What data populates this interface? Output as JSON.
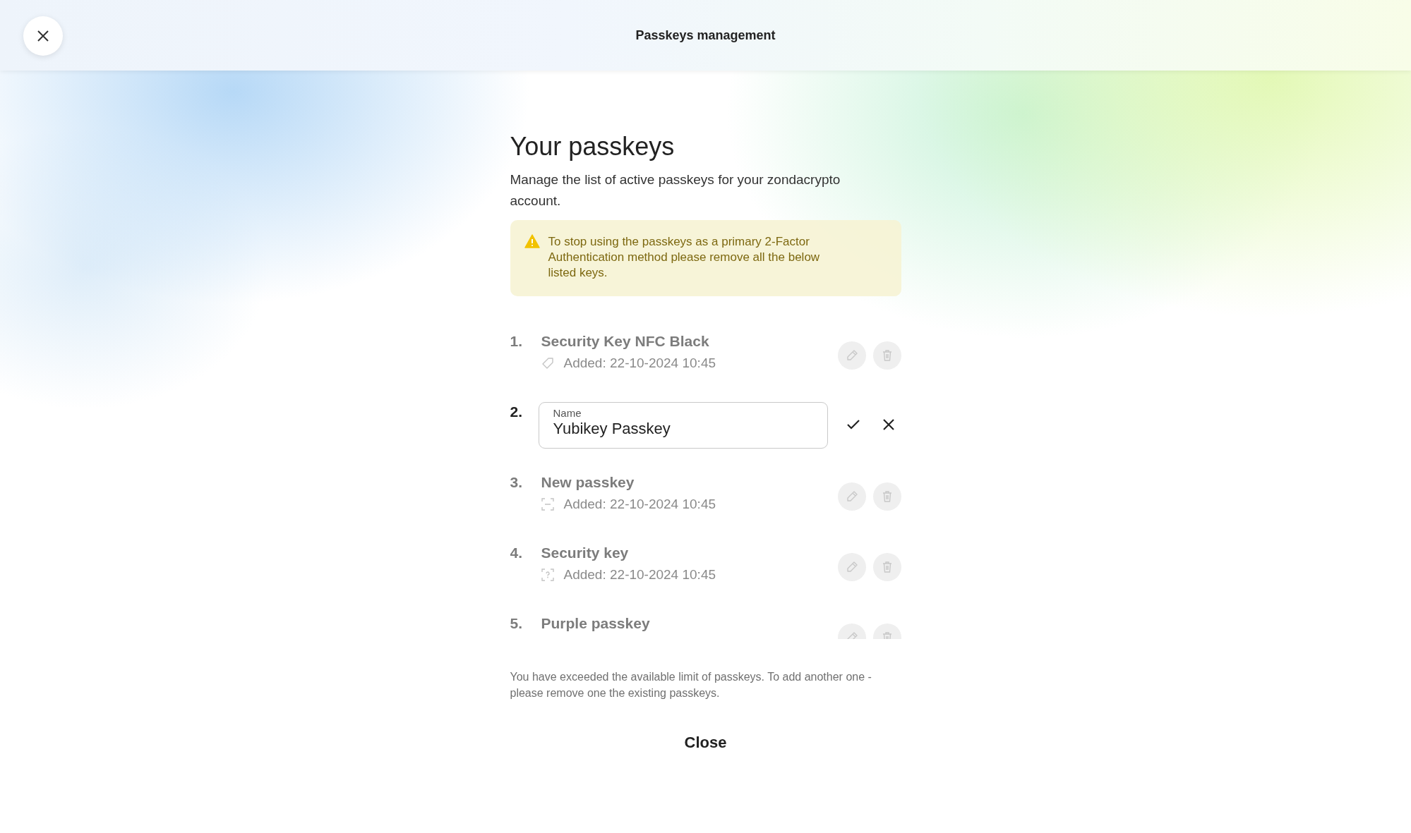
{
  "header": {
    "title": "Passkeys management"
  },
  "heading": "Your passkeys",
  "description": "Manage the list of active passkeys for your zondacrypto account.",
  "warning": {
    "text": "To stop using the passkeys as a primary 2-Factor Authentication method please remove all the below listed keys."
  },
  "passkeys": [
    {
      "kind": "display",
      "number": "1.",
      "name": "Security Key NFC Black",
      "added": "Added: 22-10-2024 10:45"
    },
    {
      "kind": "editing",
      "number": "2.",
      "field_label": "Name",
      "value": "Yubikey Passkey"
    },
    {
      "kind": "display",
      "number": "3.",
      "name": "New passkey",
      "added": "Added: 22-10-2024 10:45"
    },
    {
      "kind": "display",
      "number": "4.",
      "name": "Security key",
      "added": "Added: 22-10-2024 10:45"
    },
    {
      "kind": "display",
      "number": "5.",
      "name": "Purple passkey"
    }
  ],
  "limit_note": "You have exceeded the available limit of passkeys. To add another one - please remove one the existing passkeys.",
  "close_button": "Close"
}
